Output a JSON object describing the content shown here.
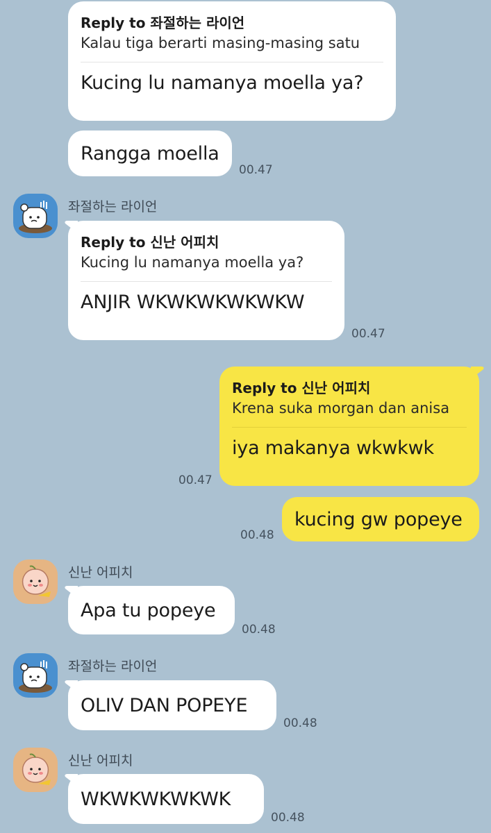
{
  "messages": {
    "m1": {
      "reply_label": "Reply to 좌절하는 라이언",
      "reply_quote": "Kalau tiga berarti masing-masing satu",
      "text": "Kucing lu namanya moella ya?"
    },
    "m2": {
      "text": "Rangga moella",
      "time": "00.47"
    },
    "m3": {
      "sender": "좌절하는 라이언",
      "reply_label": "Reply to 신난 어피치",
      "reply_quote": "Kucing lu namanya moella ya?",
      "text": "ANJIR WKWKWKWKWKW",
      "time": "00.47"
    },
    "m4": {
      "reply_label": "Reply to 신난 어피치",
      "reply_quote": "Krena suka morgan dan anisa",
      "text": "iya makanya wkwkwk",
      "time": "00.47"
    },
    "m5": {
      "text": "kucing gw popeye",
      "time": "00.48"
    },
    "m6": {
      "sender": "신난 어피치",
      "text": "Apa tu popeye",
      "time": "00.48"
    },
    "m7": {
      "sender": "좌절하는 라이언",
      "text": "OLIV DAN POPEYE",
      "time": "00.48"
    },
    "m8": {
      "sender": "신난 어피치",
      "text": "WKWKWKWKWK",
      "time": "00.48"
    }
  },
  "avatars": {
    "ryan": {
      "icon": "ryan-character-avatar-icon",
      "color": "#4a90cf"
    },
    "apeach": {
      "icon": "apeach-character-avatar-icon",
      "color": "#e6b583"
    }
  },
  "colors": {
    "background": "#abc1d1",
    "my_bubble": "#f8e545",
    "other_bubble": "#ffffff"
  }
}
